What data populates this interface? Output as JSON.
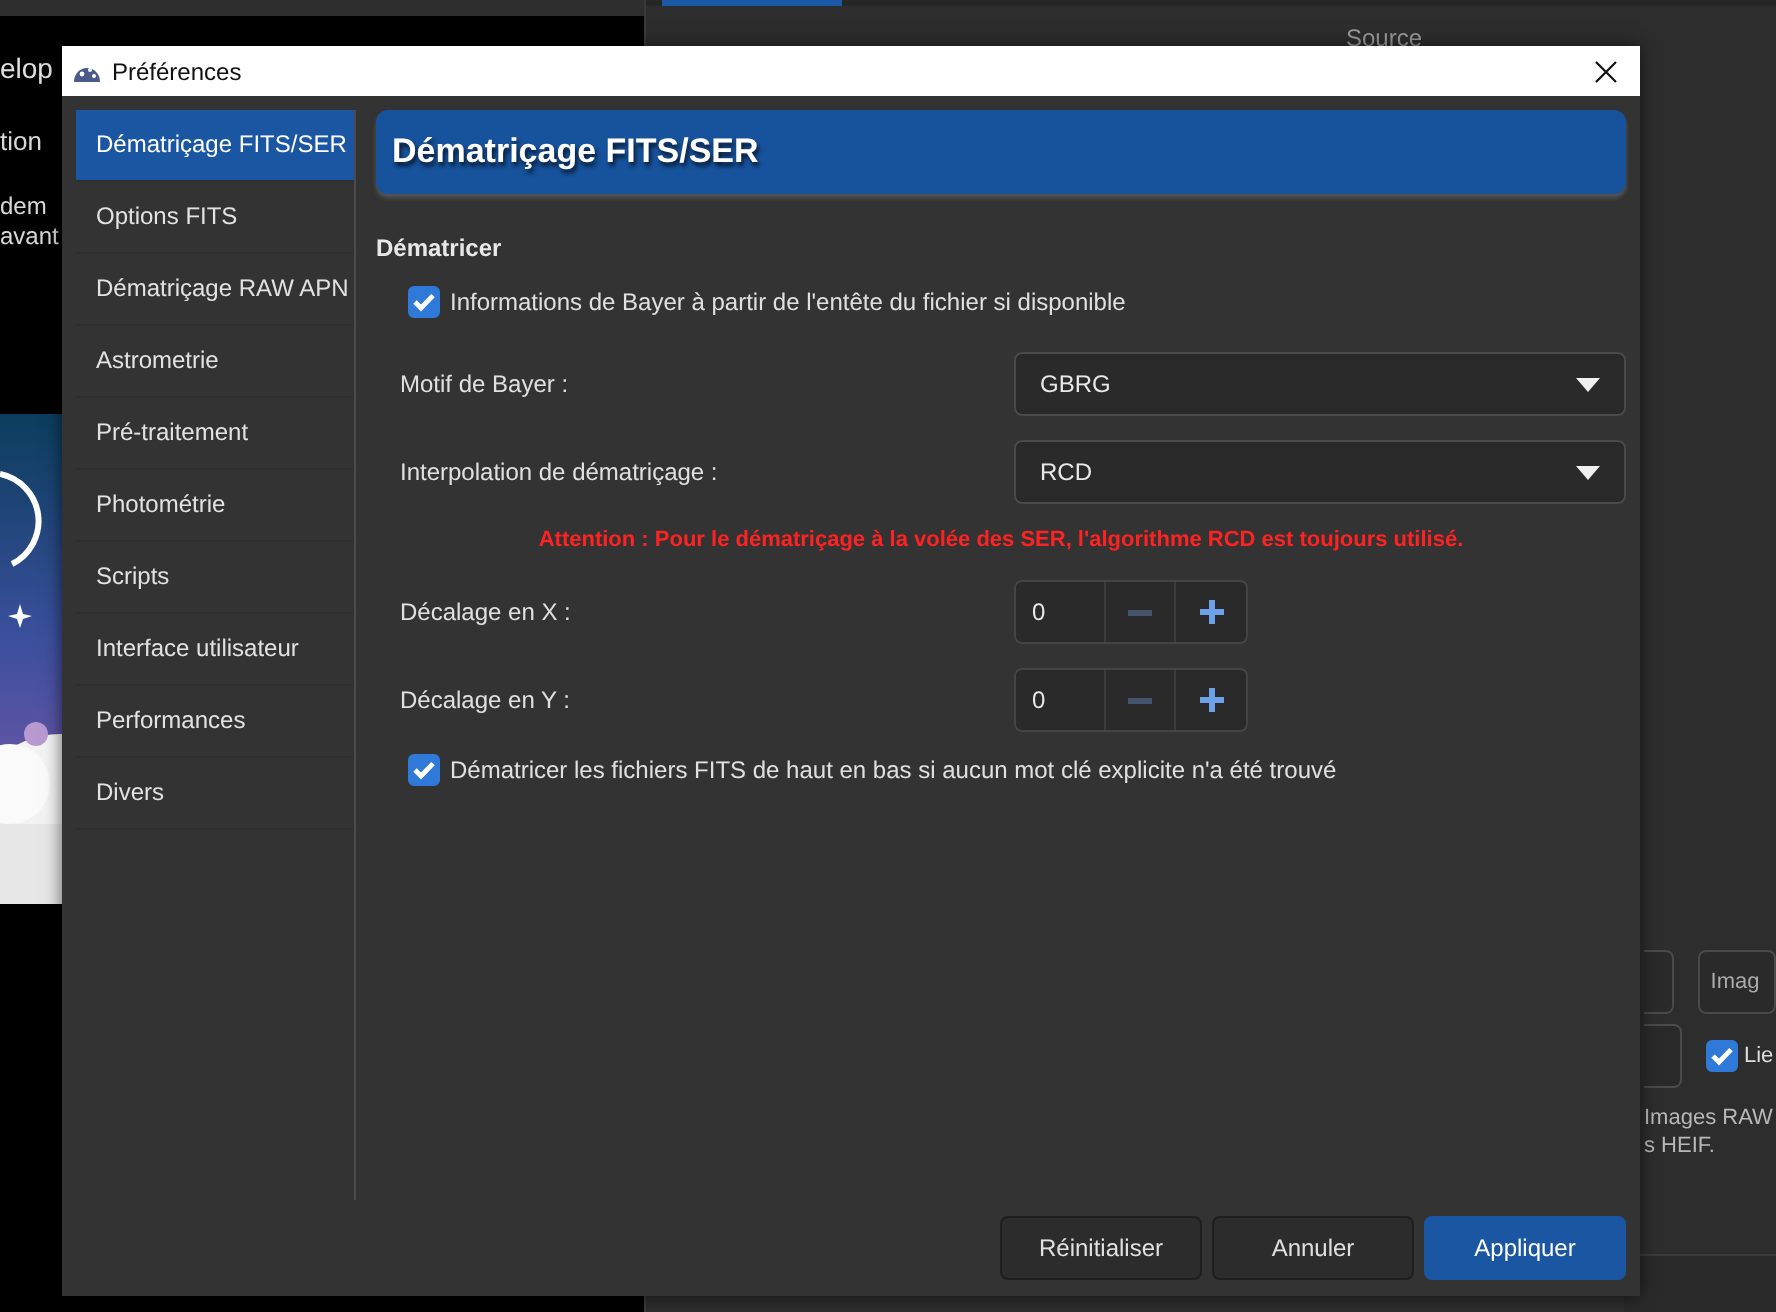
{
  "background_window": {
    "left_panel": {
      "texts": [
        {
          "kind": "title",
          "text": "elop"
        },
        {
          "kind": "label",
          "text": "tion"
        },
        {
          "kind": "line",
          "text": "dem"
        },
        {
          "kind": "line",
          "text": "avant"
        }
      ]
    },
    "right_panel": {
      "header": "Source",
      "field_value": "Imag",
      "checkbox": {
        "label": "Lie",
        "checked": true
      },
      "note_lines": [
        "Images RAW",
        "s HEIF."
      ]
    }
  },
  "dialog": {
    "title": "Préférences",
    "sidebar": {
      "items": [
        {
          "label": "Dématriçage FITS/SER",
          "selected": true
        },
        {
          "label": "Options FITS",
          "selected": false
        },
        {
          "label": "Dématriçage RAW APN",
          "selected": false
        },
        {
          "label": "Astrometrie",
          "selected": false
        },
        {
          "label": "Pré-traitement",
          "selected": false
        },
        {
          "label": "Photométrie",
          "selected": false
        },
        {
          "label": "Scripts",
          "selected": false
        },
        {
          "label": "Interface utilisateur",
          "selected": false
        },
        {
          "label": "Performances",
          "selected": false
        },
        {
          "label": "Divers",
          "selected": false
        }
      ]
    },
    "page": {
      "heading": "Dématriçage FITS/SER",
      "section": "Dématricer",
      "rows": [
        {
          "kind": "checkbox",
          "label": "Informations de Bayer à partir de l'entête du fichier si disponible",
          "checked": true
        },
        {
          "kind": "combo",
          "label": "Motif de Bayer :",
          "value": "GBRG"
        },
        {
          "kind": "combo",
          "label": "Interpolation de dématriçage :",
          "value": "RCD"
        },
        {
          "kind": "warning",
          "text": "Attention : Pour le dématriçage à la volée des SER, l'algorithme RCD est toujours utilisé."
        },
        {
          "kind": "spin",
          "label": "Décalage en X :",
          "value": "0",
          "decrement_disabled": true
        },
        {
          "kind": "spin",
          "label": "Décalage en Y :",
          "value": "0",
          "decrement_disabled": true
        },
        {
          "kind": "checkbox",
          "label": "Dématricer les fichiers FITS de haut en bas si aucun mot clé explicite n'a été trouvé",
          "checked": true
        }
      ]
    },
    "buttons": [
      {
        "label": "Réinitialiser",
        "primary": false
      },
      {
        "label": "Annuler",
        "primary": false
      },
      {
        "label": "Appliquer",
        "primary": true
      }
    ]
  }
}
